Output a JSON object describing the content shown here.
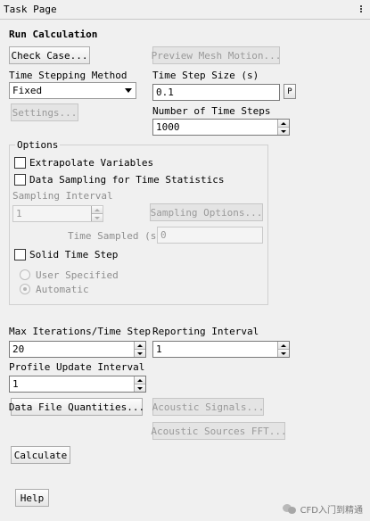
{
  "window": {
    "title": "Task Page"
  },
  "run": {
    "heading": "Run Calculation",
    "check_case": "Check Case...",
    "preview_mesh": "Preview Mesh Motion...",
    "time_stepping_label": "Time Stepping Method",
    "time_stepping_value": "Fixed",
    "time_step_size_label": "Time Step Size (s)",
    "time_step_size_value": "0.1",
    "p_button": "P",
    "settings": "Settings...",
    "num_steps_label": "Number of Time Steps",
    "num_steps_value": "1000"
  },
  "options": {
    "title": "Options",
    "extrapolate": "Extrapolate Variables",
    "data_sampling": "Data Sampling for Time Statistics",
    "sampling_interval_label": "Sampling Interval",
    "sampling_interval_value": "1",
    "sampling_options": "Sampling Options...",
    "time_sampled_label": "Time Sampled (s)",
    "time_sampled_value": "0",
    "solid_time_step": "Solid Time Step",
    "user_specified": "User Specified",
    "automatic": "Automatic"
  },
  "iteration": {
    "max_iter_label": "Max Iterations/Time Step",
    "max_iter_value": "20",
    "reporting_label": "Reporting Interval",
    "reporting_value": "1",
    "profile_label": "Profile Update Interval",
    "profile_value": "1",
    "data_file": "Data File Quantities...",
    "acoustic_signals": "Acoustic Signals...",
    "acoustic_fft": "Acoustic Sources FFT..."
  },
  "actions": {
    "calculate": "Calculate",
    "help": "Help"
  },
  "watermark": {
    "text": "CFD入门到精通"
  }
}
